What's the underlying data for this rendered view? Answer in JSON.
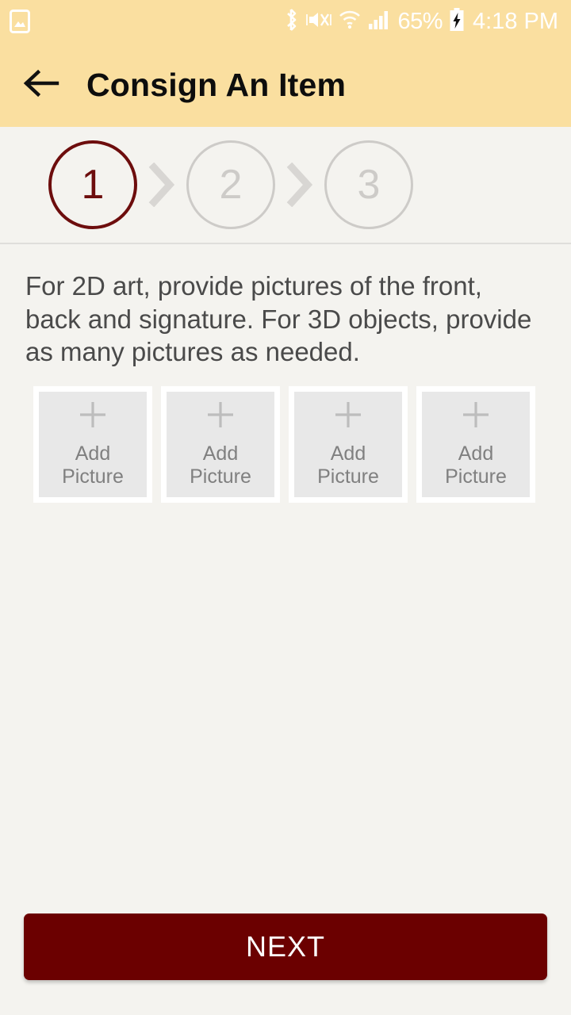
{
  "statusbar": {
    "notification_icon": "gallery-image-icon",
    "bluetooth_icon": "bluetooth-icon",
    "mute_icon": "volume-mute-vibrate-icon",
    "wifi_icon": "wifi-icon",
    "signal_icon": "cellular-signal-icon",
    "battery_percent": "65%",
    "battery_icon": "battery-charging-icon",
    "time": "4:18 PM",
    "text_color": "#ffffff",
    "background_color": "#fadfa0"
  },
  "appbar": {
    "back_icon": "back-arrow-icon",
    "title": "Consign An Item",
    "background_color": "#fadfa0",
    "title_color": "#0d0d0d"
  },
  "stepper": {
    "active_color": "#6d0d0d",
    "inactive_color": "#cdcbc8",
    "chevron_icon": "chevron-right-icon",
    "steps": [
      {
        "label": "1",
        "state": "active"
      },
      {
        "label": "2",
        "state": "inactive"
      },
      {
        "label": "3",
        "state": "inactive"
      }
    ]
  },
  "main": {
    "instructions": "For 2D art, provide pictures of the front, back and signature. For 3D objects, provide as many pictures as needed.",
    "instructions_color": "#4a4a4a",
    "tile_icon": "plus-icon",
    "tiles": [
      {
        "line1": "Add",
        "line2": "Picture"
      },
      {
        "line1": "Add",
        "line2": "Picture"
      },
      {
        "line1": "Add",
        "line2": "Picture"
      },
      {
        "line1": "Add",
        "line2": "Picture"
      }
    ]
  },
  "footer": {
    "next_label": "NEXT",
    "next_bg_color": "#6b0000",
    "next_text_color": "#ffffff"
  },
  "page": {
    "background_color": "#f4f3ef"
  }
}
